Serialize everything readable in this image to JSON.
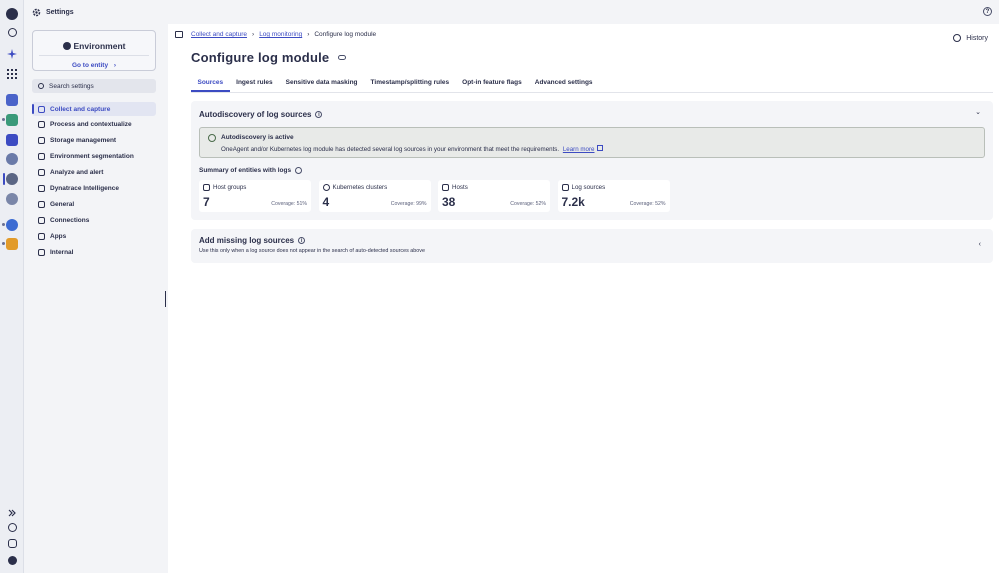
{
  "topbar": {
    "title": "Settings"
  },
  "sidebar": {
    "environment_title": "Environment",
    "goto_label": "Go to entity",
    "goto_chevron": "›",
    "search_placeholder": "Search settings",
    "items": [
      {
        "label": "Collect and capture",
        "icon": "collect-icon",
        "active": true
      },
      {
        "label": "Process and contextualize",
        "icon": "process-icon"
      },
      {
        "label": "Storage management",
        "icon": "storage-icon"
      },
      {
        "label": "Environment segmentation",
        "icon": "segmentation-icon"
      },
      {
        "label": "Analyze and alert",
        "icon": "analyze-icon"
      },
      {
        "label": "Dynatrace Intelligence",
        "icon": "intelligence-icon"
      },
      {
        "label": "General",
        "icon": "general-icon"
      },
      {
        "label": "Connections",
        "icon": "connections-icon"
      },
      {
        "label": "Apps",
        "icon": "apps-icon"
      },
      {
        "label": "Internal",
        "icon": "internal-icon"
      }
    ]
  },
  "breadcrumb": {
    "items": [
      "Collect and capture",
      "Log monitoring",
      "Configure log module"
    ],
    "separator": "›"
  },
  "header": {
    "history_label": "History",
    "page_title": "Configure log module"
  },
  "tabs": [
    "Sources",
    "Ingest rules",
    "Sensitive data masking",
    "Timestamp/splitting rules",
    "Opt-in feature flags",
    "Advanced settings"
  ],
  "autodiscovery": {
    "title": "Autodiscovery of log sources",
    "info_glyph": "i",
    "chevron": "⌄",
    "banner_title": "Autodiscovery is active",
    "banner_text": "OneAgent and/or Kubernetes log module has detected several log sources in your environment that meet the requirements.",
    "learn_more": "Learn more",
    "summary_title": "Summary of entities with logs",
    "tiles": [
      {
        "name": "Host groups",
        "value": "7",
        "coverage": "Coverage: 51%"
      },
      {
        "name": "Kubernetes clusters",
        "value": "4",
        "coverage": "Coverage: 99%"
      },
      {
        "name": "Hosts",
        "value": "38",
        "coverage": "Coverage: 52%"
      },
      {
        "name": "Log sources",
        "value": "7.2k",
        "coverage": "Coverage: 52%"
      }
    ]
  },
  "missing": {
    "title": "Add missing log sources",
    "info_glyph": "i",
    "chevron": "‹",
    "description": "Use this only when a log source does not appear in the search of auto-detected sources above"
  },
  "help_glyph": "?",
  "colors": {
    "accent": "#3c4bc2",
    "text": "#2b2f4a",
    "success_banner": "#e8eae8"
  }
}
